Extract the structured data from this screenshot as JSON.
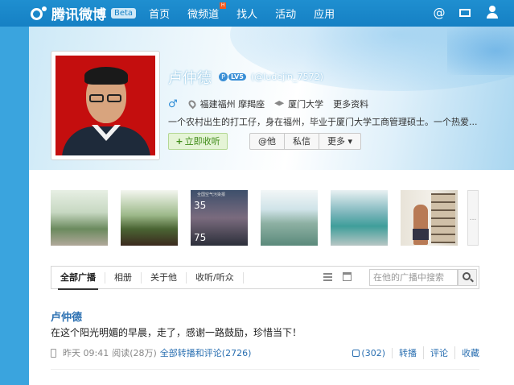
{
  "topbar": {
    "logo_text": "腾讯微博",
    "beta": "Beta",
    "nav": [
      "首页",
      "微频道",
      "找人",
      "活动",
      "应用"
    ],
    "hot_badge": "H",
    "at_icon": "@"
  },
  "profile": {
    "name": "卢仲德",
    "level": "LV5",
    "handle": "(@ludejin_7572)",
    "gender": "♂",
    "location": "福建福州 摩羯座",
    "school": "厦门大学",
    "more_info": "更多资料",
    "bio": "一个农村出生的打工仔，身在福州，毕业于厦门大学工商管理硕士。一个热爱...",
    "follow": "立即收听",
    "actions": [
      "@他",
      "私信",
      "更多 ▾"
    ]
  },
  "photos": {
    "p3_title": "全国空气污染报",
    "p3_top": "35",
    "p3_bottom": "75",
    "more": "..."
  },
  "tabs": {
    "items": [
      "全部广播",
      "相册",
      "关于他",
      "收听/听众"
    ],
    "search_placeholder": "在他的广播中搜索"
  },
  "post": {
    "author": "卢仲德",
    "text": "在这个阳光明媚的早晨，走了，感谢一路鼓励，珍惜当下！",
    "time": "昨天 09:41",
    "reads": "阅读(28万)",
    "comments_link": "全部转播和评论(2726)",
    "likes": "(302)",
    "repost": "转播",
    "comment": "评论",
    "favorite": "收藏"
  },
  "colors": {
    "topbar": "#1580c4",
    "accent_link": "#2a6fb1",
    "follow_green": "#3d8a16"
  }
}
